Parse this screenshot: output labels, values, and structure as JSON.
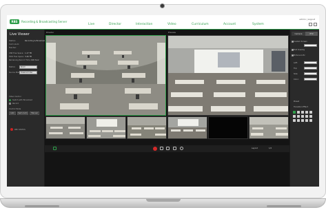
{
  "app": {
    "logo": "RBS",
    "name": "Recording & Broadcasting Server",
    "user_info": "admin | Logout"
  },
  "nav": {
    "items": [
      {
        "label": "Live"
      },
      {
        "label": "Director"
      },
      {
        "label": "Interaction"
      },
      {
        "label": "Video"
      },
      {
        "label": "Curriculum"
      },
      {
        "label": "Account"
      },
      {
        "label": "System"
      }
    ]
  },
  "left": {
    "title": "Live Viewer",
    "rows": [
      {
        "label": "Station:",
        "value": "Recording & Broadcast"
      },
      {
        "label": "Curriculum:",
        "value": ""
      },
      {
        "label": "Teacher:",
        "value": ""
      },
      {
        "label": "USB Free Space:",
        "value": "1.27 TB"
      },
      {
        "label": "HDD Free Space:",
        "value": "3.46 TB"
      },
      {
        "label": "Remaining Record Time:",
        "value": "100 hour"
      }
    ],
    "station_select_label": "Station",
    "station_select_value": "Room",
    "source_select_label": "Source Mode",
    "source_select_value": "Classroom Rec",
    "video_control_label": "Video Control",
    "radio_1": "Switch with Broadcast",
    "radio_2": "Record",
    "control_mode_label": "Control Mode",
    "mode_buttons": [
      "Auto",
      "Semi-Auto",
      "Manual"
    ],
    "rec_label": "REC STATUS"
  },
  "video": {
    "main_label": "Director",
    "preview_label": "Preview",
    "controls_text": "Layout",
    "status_text": "1/2",
    "thumbnails": [
      {
        "name": "thumb-classroom-1"
      },
      {
        "name": "thumb-classroom-2"
      },
      {
        "name": "thumb-classroom-3"
      },
      {
        "name": "thumb-classroom-4"
      },
      {
        "name": "thumb-black"
      },
      {
        "name": "thumb-classroom-6"
      }
    ]
  },
  "right": {
    "tabs": [
      "Camera",
      "PTZ"
    ],
    "rows": [
      {
        "label": "Custom Screen"
      },
      {
        "label": "Text Overlay"
      },
      {
        "label": "Picture-in-Pic"
      }
    ],
    "fields": [
      {
        "label": "Left:"
      },
      {
        "label": "Top:"
      },
      {
        "label": "Size:"
      },
      {
        "label": "Color:"
      }
    ],
    "preset_label": "Preset",
    "transition_label": "Transition Effect"
  },
  "colors": {
    "accent": "#2e9e4a",
    "panel": "#2a2a2a",
    "record": "#d52a2a"
  }
}
